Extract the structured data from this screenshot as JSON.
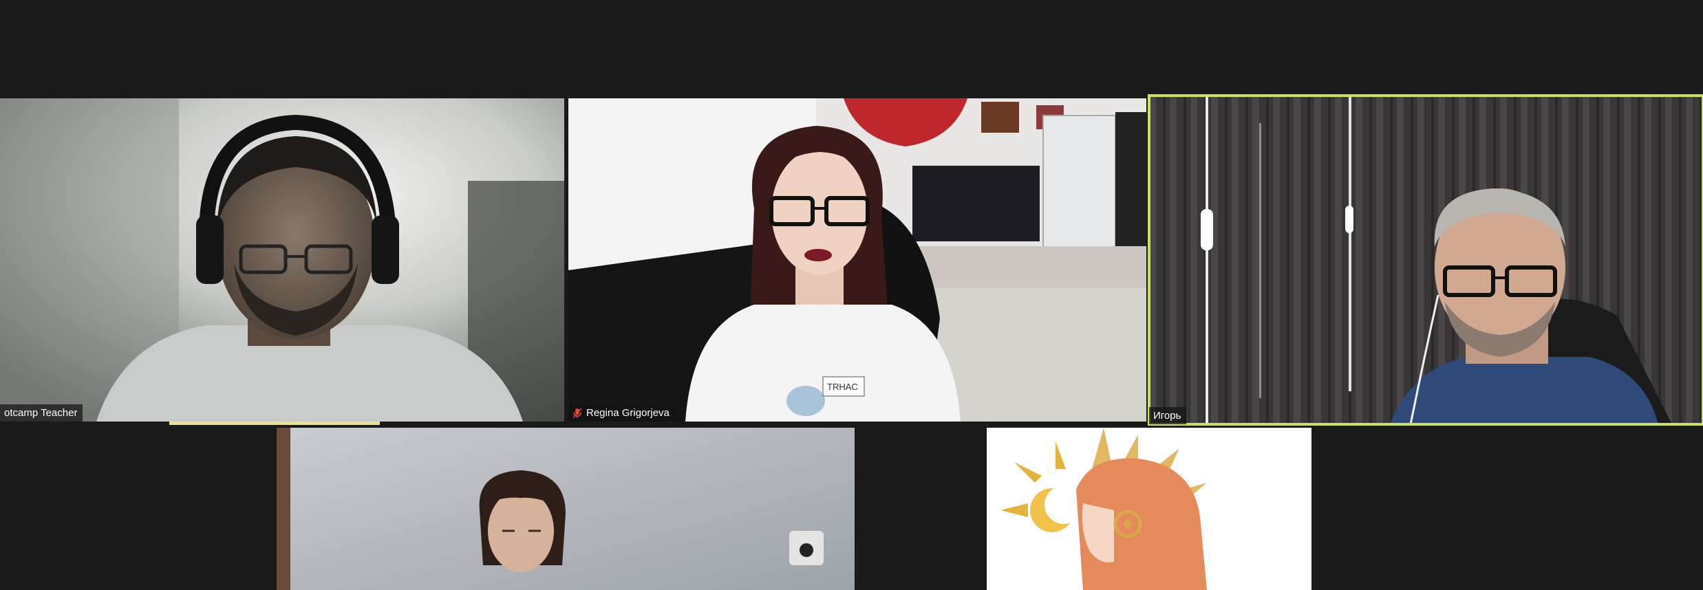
{
  "participants": [
    {
      "id": "tile-1",
      "name": "otcamp Teacher",
      "muted": false,
      "active": false
    },
    {
      "id": "tile-2",
      "name": "Regina Grigorjeva",
      "muted": true,
      "active": false
    },
    {
      "id": "tile-3",
      "name": "Игорь",
      "muted": false,
      "active": true
    },
    {
      "id": "tile-4",
      "name": "",
      "muted": false,
      "active": false
    },
    {
      "id": "tile-5",
      "name": "",
      "muted": false,
      "active": false
    }
  ],
  "colors": {
    "background": "#1a1a1a",
    "active_speaker_border": "#c8e35a",
    "muted_icon": "#e0463b"
  },
  "icons": {
    "mute": "microphone-slash-icon"
  },
  "shirt_text": "TRHAC"
}
